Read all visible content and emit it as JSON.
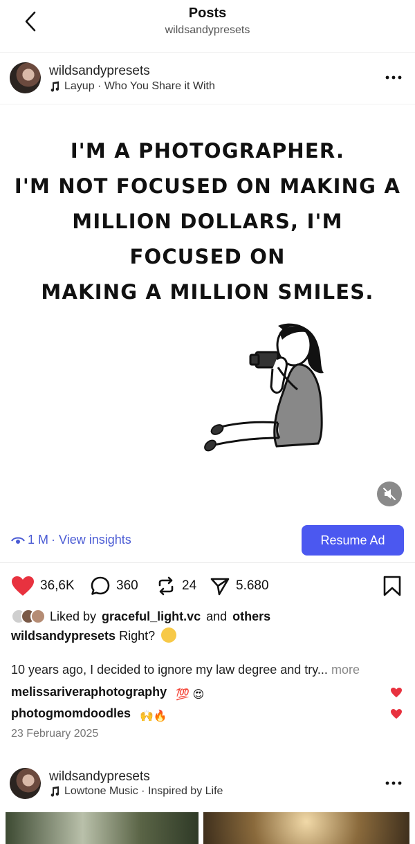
{
  "header": {
    "title": "Posts",
    "subtitle": "wildsandypresets"
  },
  "post": {
    "username": "wildsandypresets",
    "song": "Layup · Who You Share it With",
    "quote_lines": [
      "I'M A PHOTOGRAPHER.",
      "I'M NOT FOCUSED ON MAKING A",
      "MILLION DOLLARS, I'M FOCUSED ON",
      "MAKING A MILLION SMILES."
    ],
    "views": "1 M",
    "insights_label": "· View insights",
    "resume_label": "Resume Ad",
    "likes": "36,6K",
    "comments": "360",
    "reposts": "24",
    "shares": "5.680",
    "liked_by_prefix": "Liked by",
    "liked_by_user": "graceful_light.vc",
    "liked_by_and": "and",
    "liked_by_others": "others",
    "caption_user": "wildsandypresets",
    "caption_text": "Right?",
    "story_text": "10 years ago, I decided to ignore my law degree and try...",
    "story_more": "more",
    "comments_list": [
      {
        "user": "melissariveraphotography",
        "emoji": "💯 😍"
      },
      {
        "user": "photogmomdoodles",
        "emoji": "🙌🔥"
      }
    ],
    "date": "23 February 2025"
  },
  "next_post": {
    "username": "wildsandypresets",
    "song": "Lowtone Music · Inspired by Life"
  },
  "colors": {
    "accent": "#4b58f0",
    "link": "#4a5bd4",
    "like_red": "#e8323f"
  }
}
